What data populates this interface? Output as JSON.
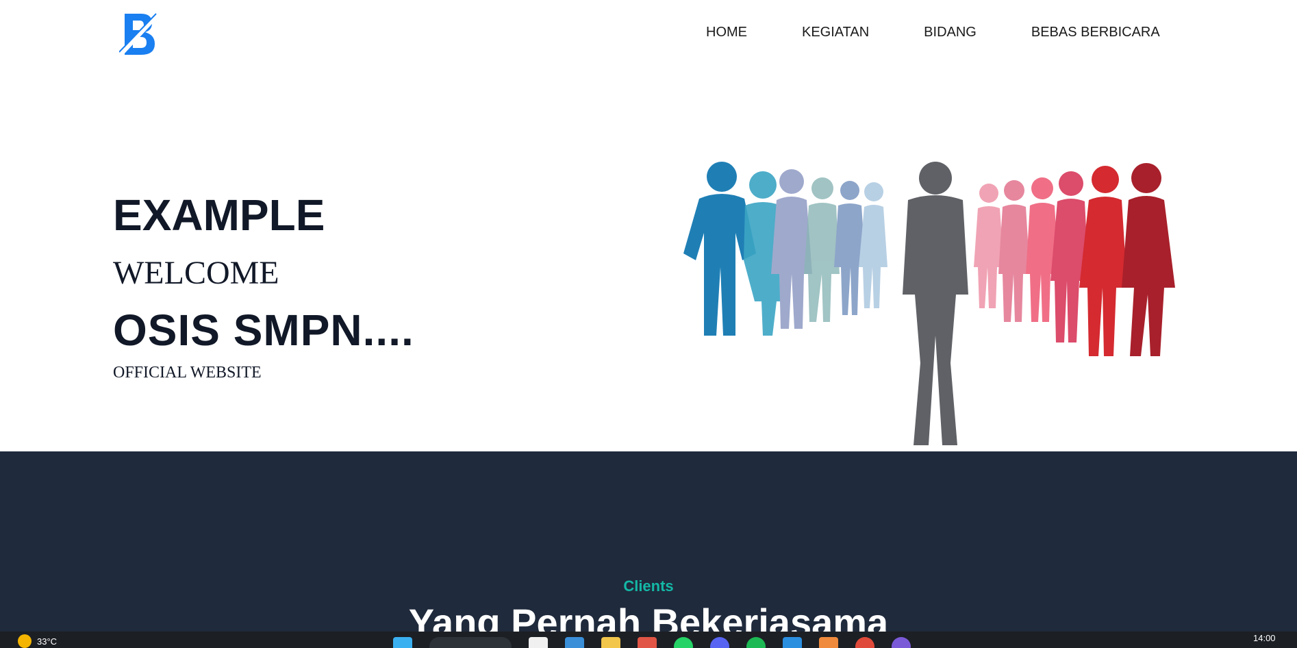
{
  "nav": {
    "logo_letter": "B",
    "links": [
      "HOME",
      "KEGIATAN",
      "BIDANG",
      "BEBAS BERBICARA"
    ]
  },
  "hero": {
    "title": "EXAMPLE",
    "welcome": "WELCOME",
    "osis": "OSIS SMPN....",
    "official": "OFFICIAL WEBSITE",
    "image_icon": "business-people-silhouettes"
  },
  "clients": {
    "tag": "Clients",
    "heading": "Yang Pernah Bekerjasama"
  },
  "taskbar": {
    "temperature": "33°C",
    "clock": "14:00",
    "icons": [
      "windows-start-icon",
      "search-bar",
      "file-icon",
      "store-icon",
      "folder-icon",
      "app-icon",
      "whatsapp-icon",
      "discord-icon",
      "spotify-icon",
      "vscode-icon",
      "app-orange-icon",
      "chrome-icon",
      "profile-icon"
    ]
  },
  "colors": {
    "accent_teal": "#14b8a6",
    "dark_navy": "#1f2a3c",
    "logo_blue": "#1a7ff0",
    "text_dark": "#111827"
  }
}
